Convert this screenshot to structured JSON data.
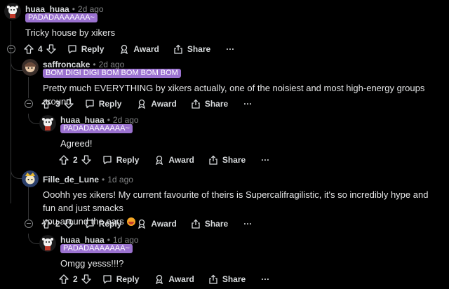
{
  "actions": {
    "reply": "Reply",
    "award": "Award",
    "share": "Share",
    "more": "···"
  },
  "colors": {
    "flair_bg": "#9b72d0",
    "background": "#000000",
    "text": "#d7dadc",
    "muted": "#818384"
  },
  "comments": [
    {
      "user": "huaa_huaa",
      "time": "2d ago",
      "flair": "PADADAAAAAAA~",
      "text": "Tricky house by xikers",
      "votes": "4",
      "collapsible": true
    },
    {
      "user": "saffroncake",
      "time": "2d ago",
      "flair": "BOM DIGI DIGI BOM BOM BOM BOM",
      "text": "Pretty much EVERYTHING by xikers actually, one of the noisiest and most high-energy groups around.",
      "votes": "3",
      "collapsible": true
    },
    {
      "user": "huaa_huaa",
      "time": "2d ago",
      "flair": "PADADAAAAAAA~",
      "text": "Agreed!",
      "votes": "2",
      "collapsible": false
    },
    {
      "user": "Fille_de_Lune",
      "time": "1d ago",
      "flair": "",
      "text_line1": "Ooohh yes xikers! My current favourite of theirs is Supercalifragilistic, it's so incredibly hype and fun and just smacks",
      "text_line2": "you around the ears",
      "votes": "2",
      "collapsible": true
    },
    {
      "user": "huaa_huaa",
      "time": "1d ago",
      "flair": "PADADAAAAAAA~",
      "text": "Omgg yesss!!!?",
      "votes": "2",
      "collapsible": false
    }
  ]
}
